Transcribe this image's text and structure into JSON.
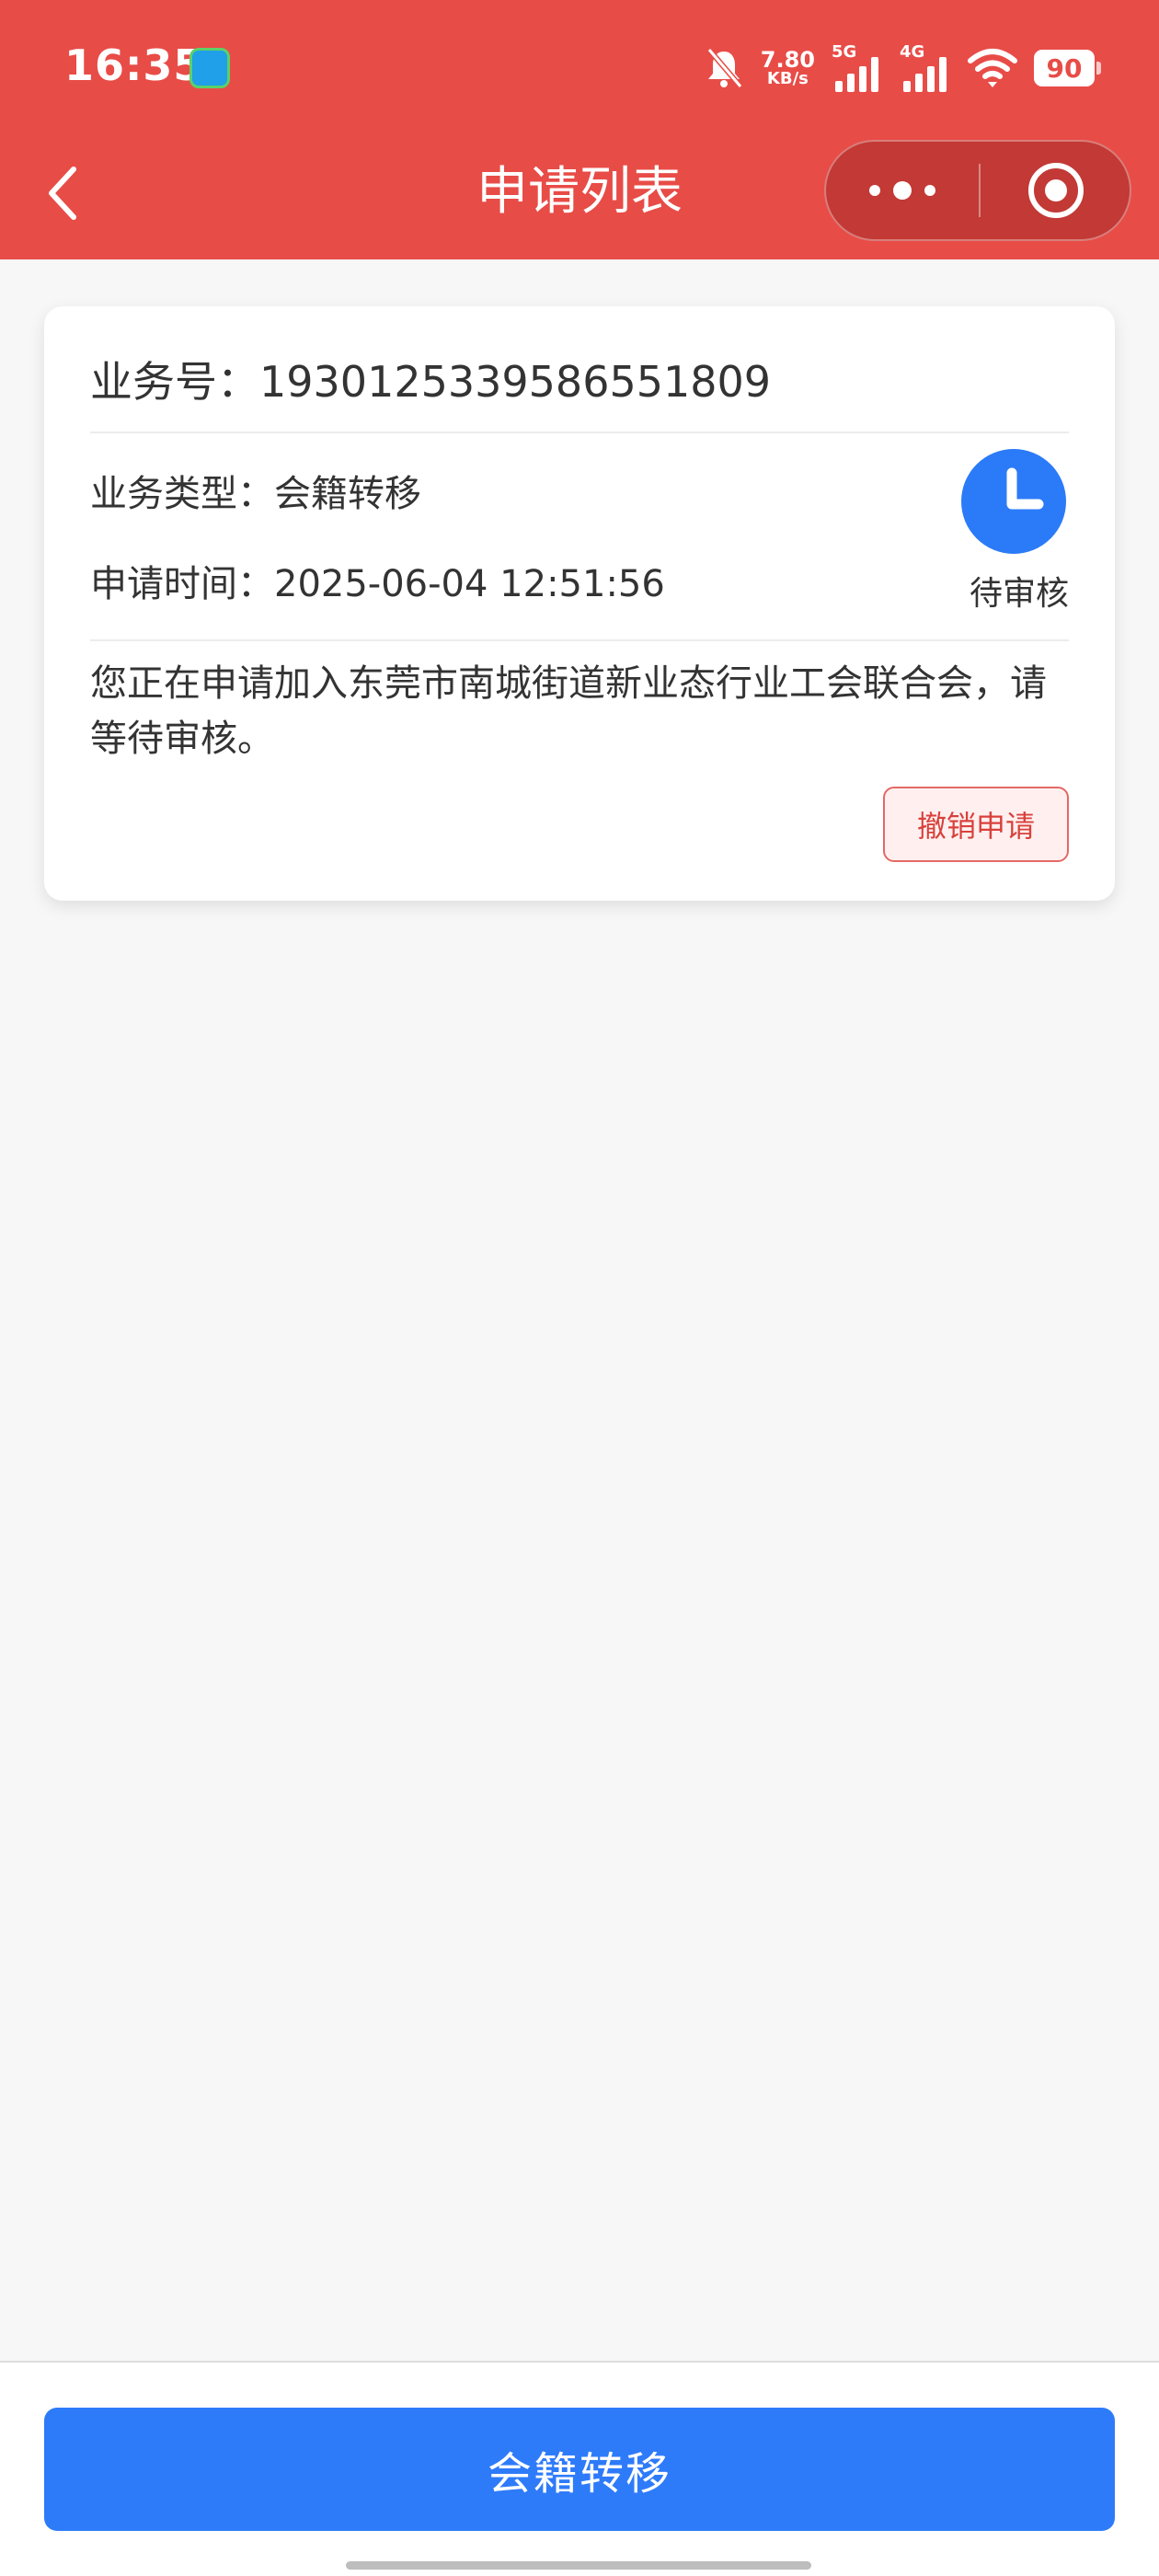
{
  "status_bar": {
    "time": "16:35",
    "net_speed_value": "7.80",
    "net_speed_unit": "KB/s",
    "signal_1_label": "5G",
    "signal_2_label": "4G",
    "battery": "90"
  },
  "nav": {
    "title": "申请列表"
  },
  "card": {
    "business_no": "业务号：1930125339586551809",
    "business_type": "业务类型：会籍转移",
    "apply_time": "申请时间：2025-06-04 12:51:56",
    "status": "待审核",
    "message": "您正在申请加入东莞市南城街道新业态行业工会联合会，请等待审核。",
    "cancel_label": "撤销申请"
  },
  "footer": {
    "transfer_label": "会籍转移"
  },
  "colors": {
    "header": "#e84c47",
    "primary": "#2e7bfa",
    "status_icon": "#2b7bf8",
    "danger": "#d8413c"
  }
}
